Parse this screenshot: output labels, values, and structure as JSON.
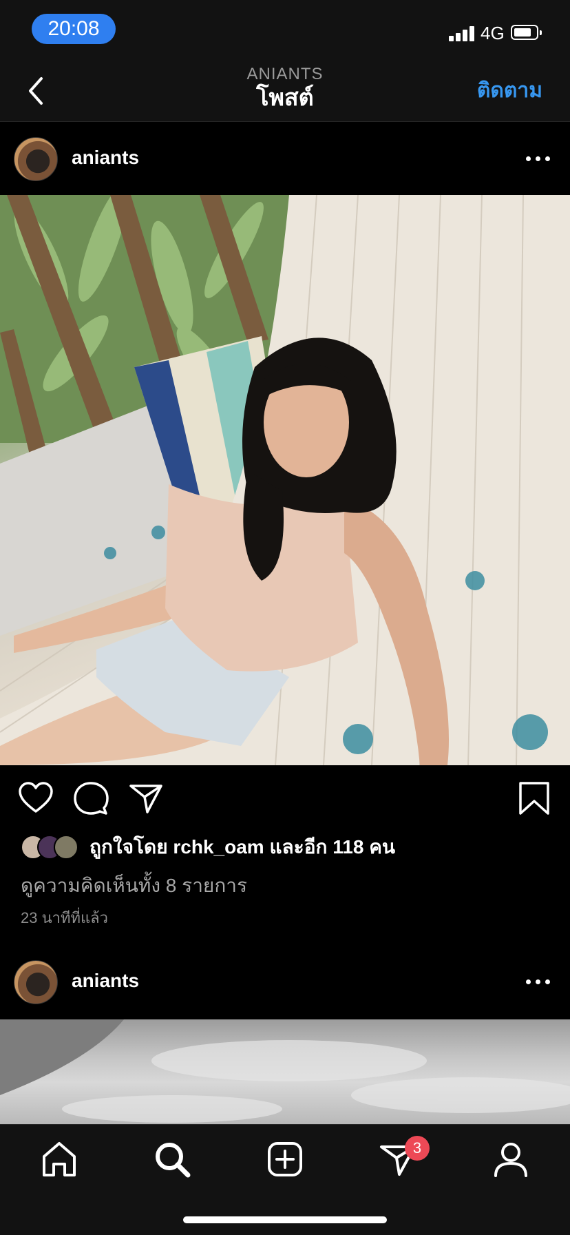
{
  "status_bar": {
    "time": "20:08",
    "network": "4G"
  },
  "nav": {
    "subtitle": "ANIANTS",
    "title": "โพสต์",
    "follow_label": "ติดตาม"
  },
  "posts": [
    {
      "username": "aniants",
      "likes_text": "ถูกใจโดย rchk_oam และอีก 118 คน",
      "view_comments": "ดูความคิดเห็นทั้ง 8 รายการ",
      "time_ago": "23 นาทีที่แล้ว"
    },
    {
      "username": "aniants"
    }
  ],
  "tab_bar": {
    "items": [
      "home-icon",
      "search-icon",
      "new-post-icon",
      "direct-icon",
      "profile-icon"
    ],
    "direct_badge": "3"
  },
  "colors": {
    "accent": "#3797f0",
    "time_pill": "#2f7ff0",
    "badge": "#ed4956",
    "bar_bg": "#121212"
  }
}
